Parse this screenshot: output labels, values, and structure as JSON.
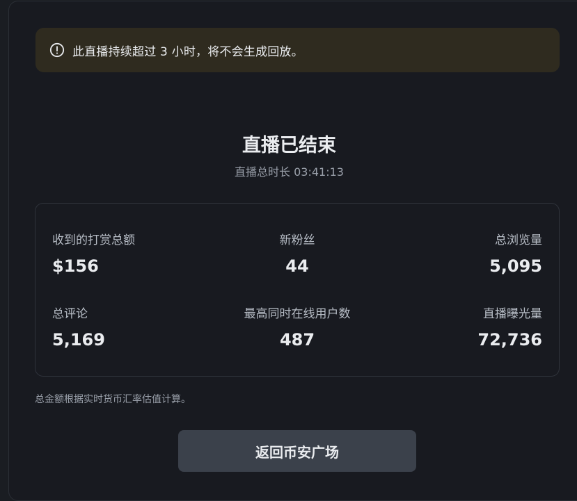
{
  "warning": {
    "icon": "exclamation-circle-icon",
    "text": "此直播持续超过 3 小时，将不会生成回放。"
  },
  "summary": {
    "title": "直播已结束",
    "duration": "直播总时长 03:41:13"
  },
  "stats": [
    {
      "label": "收到的打赏总额",
      "value": "$156"
    },
    {
      "label": "新粉丝",
      "value": "44"
    },
    {
      "label": "总浏览量",
      "value": "5,095"
    },
    {
      "label": "总评论",
      "value": "5,169"
    },
    {
      "label": "最高同时在线用户数",
      "value": "487"
    },
    {
      "label": "直播曝光量",
      "value": "72,736"
    }
  ],
  "note": "总金额根据实时货币汇率估值计算。",
  "button": {
    "label": "返回币安广场"
  },
  "colors": {
    "background": "#181a20",
    "warning_background": "#2f2b1f",
    "button_background": "#3b414b",
    "text_primary": "#eaecef",
    "text_secondary": "#9aa0aa"
  }
}
